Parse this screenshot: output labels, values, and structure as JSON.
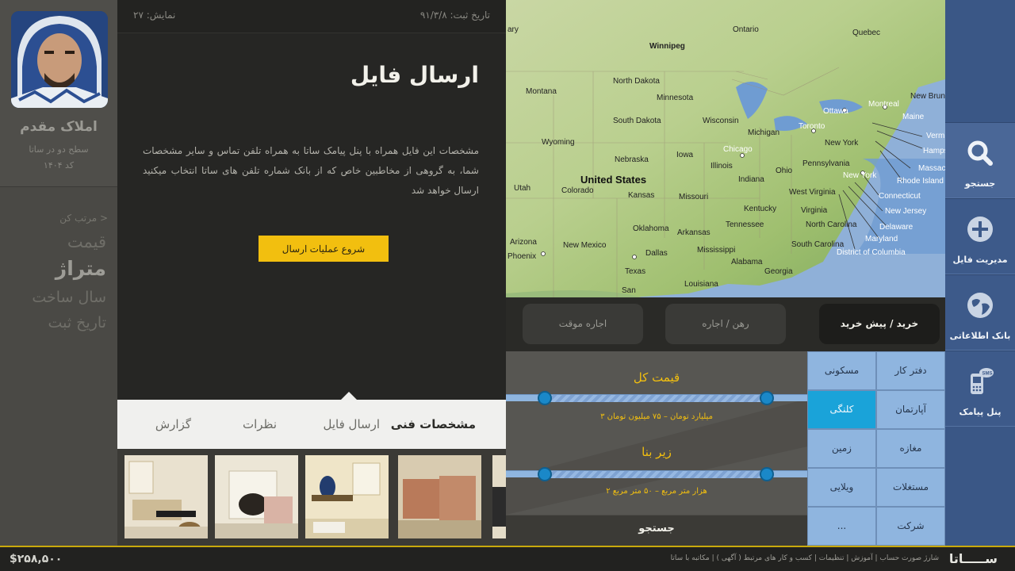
{
  "profile": {
    "name": "املاک مقدم",
    "level": "سطح دو در ساتا",
    "code": "کد ۱۴۰۴"
  },
  "sort": {
    "label": "مرتب کن >",
    "items": [
      "قیمت",
      "متراژ",
      "سال ساخت",
      "تاریخ ثبت"
    ]
  },
  "document": {
    "reg_date": "تاریخ ثبت: ۹۱/۳/۸",
    "views": "نمایش: ۲۷",
    "title": "ارسال فایل",
    "description": "مشخصات این فایل همراه با پنل پیامک ساتا به همراه تلفن تماس و سایر مشخصات شما، به گروهی از مخاطبین خاص که از بانک شماره تلفن های ساتا انتخاب میکنید ارسال خواهد شد",
    "start_button": "شروع عملیات ارسال"
  },
  "tabs": [
    "مشخصات فنی",
    "ارسال فایل",
    "نظرات",
    "گزارش"
  ],
  "map": {
    "labels": {
      "winnipeg": "Winnipeg",
      "ontario": "Ontario",
      "quebec": "Quebec",
      "montreal": "Montreal",
      "ottawa": "Ottawa",
      "maine": "Maine",
      "toronto": "Toronto",
      "north_dakota": "North Dakota",
      "montana": "Montana",
      "minnesota": "Minnesota",
      "south_dakota": "South Dakota",
      "wisconsin": "Wisconsin",
      "michigan": "Michigan",
      "wyoming": "Wyoming",
      "chicago": "Chicago",
      "iowa": "Iowa",
      "nebraska": "Nebraska",
      "illinois": "Illinois",
      "ohio": "Ohio",
      "pennsylvania": "Pennsylvania",
      "new_york": "New York",
      "new_york_city": "New York",
      "united_states": "United States",
      "utah": "Utah",
      "colorado": "Colorado",
      "kansas": "Kansas",
      "missouri": "Missouri",
      "indiana": "Indiana",
      "west_virginia": "West Virginia",
      "virginia": "Virginia",
      "kentucky": "Kentucky",
      "connecticut": "Connecticut",
      "new_jersey": "New Jersey",
      "delaware": "Delaware",
      "maryland": "Maryland",
      "district_of_columbia": "District of Columbia",
      "rhode_island": "Rhode Island",
      "massachusetts": "Massachu",
      "new_hampshire": "Hamps",
      "vermont": "Verm",
      "new_brunswick": "New Brunswi",
      "oklahoma": "Oklahoma",
      "arkansas": "Arkansas",
      "tennessee": "Tennessee",
      "north_carolina": "North Carolina",
      "arizona": "Arizona",
      "phoenix": "Phoenix",
      "new_mexico": "New Mexico",
      "dallas": "Dallas",
      "mississippi": "Mississippi",
      "alabama": "Alabama",
      "south_carolina": "South Carolina",
      "georgia": "Georgia",
      "texas": "Texas",
      "louisiana": "Louisiana",
      "san_antonio": "San",
      "gary": "ary"
    }
  },
  "nav": [
    "جستجو",
    "مدیریت فایل",
    "بانک اطلاعاتی",
    "پنل پیامک"
  ],
  "search": {
    "deal_types": [
      "خرید / پیش خرید",
      "رهن / اجاره",
      "اجاره موقت"
    ],
    "price": {
      "title": "قیمت کل",
      "value": "۳ میلیارد تومان – ۷۵ میلیون تومان",
      "min_frac": 0.0,
      "max_frac": 1.0
    },
    "area": {
      "title": "زیر بنا",
      "value": "۲ هزار متر مربع – ۵۰ متر مربع",
      "min_frac": 0.0,
      "max_frac": 1.0
    },
    "submit": "جستجو",
    "property_types": [
      [
        "دفتر کار",
        "مسکونی"
      ],
      [
        "آپارتمان",
        "کلنگی"
      ],
      [
        "مغازه",
        "زمین"
      ],
      [
        "مستغلات",
        "ویلایی"
      ],
      [
        "شرکت",
        "..."
      ]
    ],
    "active_type": "کلنگی"
  },
  "footer": {
    "price": "$۲۵۸,۵۰۰",
    "links": [
      "شارژ صورت حساب",
      "آموزش",
      "تنظیمات",
      "کسب و کار های مرتبط ( آگهی )",
      "مکاتبه با ساتا"
    ],
    "brand": "ســـــاتا"
  },
  "colors": {
    "accent": "#f2bf0f",
    "nav": "#3d5a8a",
    "type_cell": "#8fb5df",
    "type_active": "#1aa3d9"
  }
}
